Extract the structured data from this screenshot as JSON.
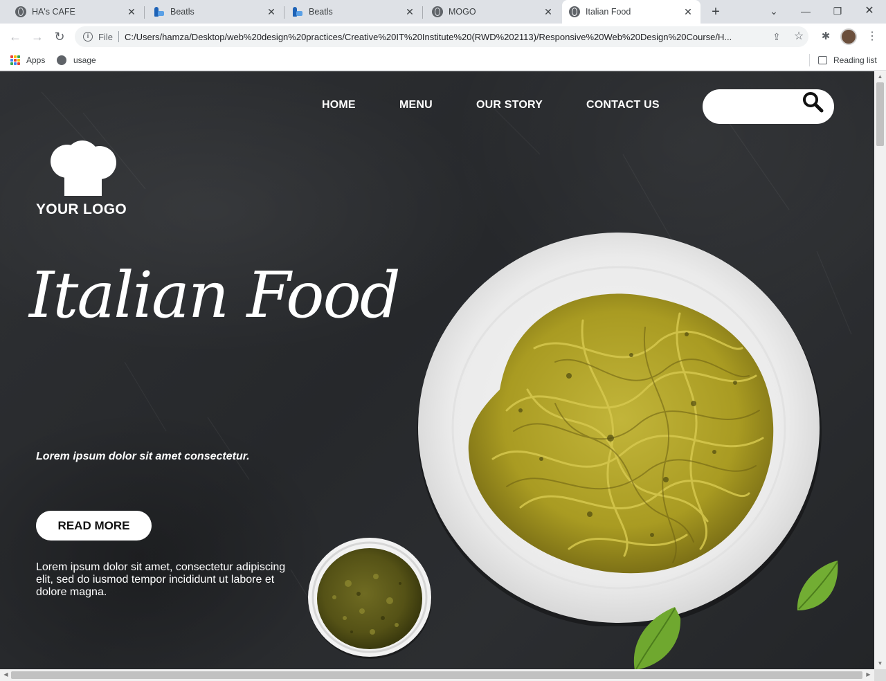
{
  "browser": {
    "tabs": [
      {
        "title": "HA's CAFE",
        "icon": "globe-icon",
        "active": false
      },
      {
        "title": "Beatls",
        "icon": "beatls-icon",
        "active": false
      },
      {
        "title": "Beatls",
        "icon": "beatls-icon",
        "active": false
      },
      {
        "title": "MOGO",
        "icon": "globe-icon",
        "active": false
      },
      {
        "title": "Italian Food",
        "icon": "globe-icon",
        "active": true
      }
    ],
    "omnibox": {
      "scheme_label": "File",
      "url": "C:/Users/hamza/Desktop/web%20design%20practices/Creative%20IT%20Institute%20(RWD%202113)/Responsive%20Web%20Design%20Course/H..."
    },
    "bookmarks": {
      "apps_label": "Apps",
      "usage_label": "usage",
      "reading_list_label": "Reading list"
    }
  },
  "page": {
    "nav": {
      "links": [
        "HOME",
        "MENU",
        "OUR STORY",
        "CONTACT US"
      ]
    },
    "search": {
      "placeholder": ""
    },
    "logo_text": "YOUR LOGO",
    "hero_title": "Italian Food",
    "tagline": "Lorem ipsum dolor sit amet consectetur.",
    "cta_label": "READ MORE",
    "body_text": "Lorem ipsum dolor sit amet, consectetur adipiscing elit, sed do iusmod tempor incididunt ut labore et dolore magna.",
    "colors": {
      "background": "#2a2c2f",
      "text": "#ffffff",
      "pasta": "#b5a82a",
      "pesto": "#5b5a1c",
      "basil": "#6aa22e"
    }
  }
}
